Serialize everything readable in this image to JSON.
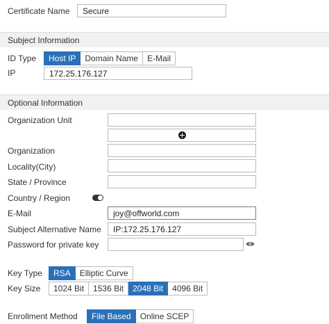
{
  "certificate": {
    "label": "Certificate Name",
    "value": "Secure"
  },
  "subject_section": {
    "title": "Subject Information"
  },
  "id_type": {
    "label": "ID Type",
    "options": [
      "Host IP",
      "Domain Name",
      "E-Mail"
    ],
    "selected": "Host IP"
  },
  "ip": {
    "label": "IP",
    "value": "172.25.176.127"
  },
  "optional_section": {
    "title": "Optional Information"
  },
  "org_unit": {
    "label": "Organization Unit",
    "value": "",
    "add_icon": "plus-circle-icon"
  },
  "organization": {
    "label": "Organization",
    "value": ""
  },
  "locality": {
    "label": "Locality(City)",
    "value": ""
  },
  "state": {
    "label": "State / Province",
    "value": ""
  },
  "country": {
    "label": "Country / Region",
    "toggle_icon": "toggle-icon"
  },
  "email": {
    "label": "E-Mail",
    "value": "joy@offworld.com"
  },
  "san": {
    "label": "Subject Alternative Name",
    "value": "IP:172.25.176.127"
  },
  "password": {
    "label": "Password for private key",
    "value": "",
    "reveal_icon": "eye-icon"
  },
  "key_type": {
    "label": "Key Type",
    "options": [
      "RSA",
      "Elliptic Curve"
    ],
    "selected": "RSA"
  },
  "key_size": {
    "label": "Key Size",
    "options": [
      "1024 Bit",
      "1536 Bit",
      "2048 Bit",
      "4096 Bit"
    ],
    "selected": "2048 Bit"
  },
  "enrollment": {
    "label": "Enrollment Method",
    "options": [
      "File Based",
      "Online SCEP"
    ],
    "selected": "File Based"
  },
  "colors": {
    "accent": "#2a70b8",
    "section_bg": "#f1f1f1",
    "border": "#b9b9b9"
  }
}
